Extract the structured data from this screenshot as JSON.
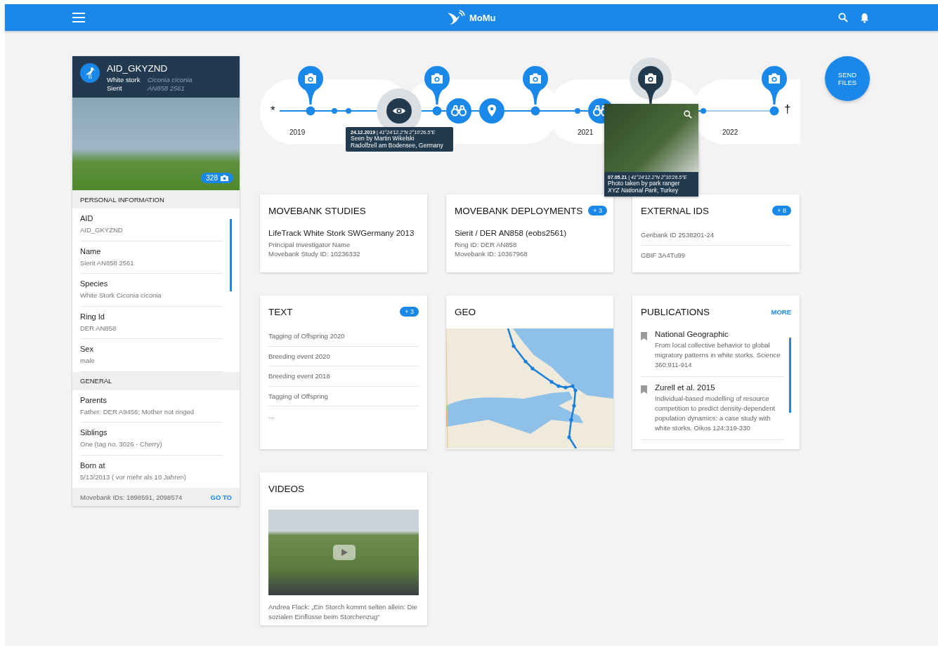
{
  "app_bar": {
    "title": "MoMu"
  },
  "profile": {
    "title": "AID_GKYZND",
    "rows": [
      {
        "label": "White stork",
        "value": "Ciconia ciconia"
      },
      {
        "label": "Sierit",
        "value": "AN858 2561"
      }
    ],
    "photo_count": "328",
    "sections": [
      {
        "title": "PERSONAL INFORMATION",
        "items": [
          {
            "label": "AID",
            "value": "AID_GKYZND"
          },
          {
            "label": "Name",
            "value": "Sierit AN858 2561"
          },
          {
            "label": "Species",
            "value": "White Stork Ciconia ciconia"
          },
          {
            "label": "Ring Id",
            "value": "DER AN858"
          },
          {
            "label": "Sex",
            "value": "male"
          }
        ]
      },
      {
        "title": "GENERAL",
        "items": [
          {
            "label": "Parents",
            "value": "Father: DER A9456; Mother not ringed"
          },
          {
            "label": "Siblings",
            "value": "One (tag no. 3026 - Cherry)"
          },
          {
            "label": "Born at",
            "value": "5/13/2013 ( vor mehr als 10 Jahren)"
          }
        ]
      }
    ],
    "footer": {
      "text": "Movebank IDs: 1898591, 2098574",
      "link": "GO TO"
    }
  },
  "timeline": {
    "start_mark": "*",
    "end_mark": "†",
    "years": [
      "2019",
      "2021",
      "2022"
    ],
    "events": [
      {
        "kind": "photo",
        "selected": false
      },
      {
        "kind": "dot",
        "selected": false
      },
      {
        "kind": "dot",
        "selected": false
      },
      {
        "kind": "sighting",
        "selected": true,
        "tooltip": {
          "header": "**24.12.2019** | *41°24'12.2\"N 2°10'26.5\"E*",
          "lines": [
            "Seen by Martin Wikelski",
            "Radolfzell am Bodensee, Germany"
          ]
        }
      },
      {
        "kind": "photo",
        "selected": false
      },
      {
        "kind": "observation",
        "selected": false
      },
      {
        "kind": "location",
        "selected": false
      },
      {
        "kind": "photo",
        "selected": false
      },
      {
        "kind": "dot",
        "selected": false
      },
      {
        "kind": "observation",
        "selected": false
      },
      {
        "kind": "photo",
        "selected": true,
        "tooltip": {
          "header": "**07.05.21** | *41°24'12.2\"N 2°10'26.5\"E*",
          "lines": [
            "Photo taken by park ranger",
            "*XYZ National Park*, Turkey"
          ]
        }
      },
      {
        "kind": "dot",
        "selected": false
      },
      {
        "kind": "photo",
        "selected": false
      }
    ]
  },
  "send_button": "SEND FILES",
  "cards": [
    {
      "kind": "detail",
      "title": "MOVEBANK STUDIES",
      "heading": "LifeTrack White Stork SWGermany 2013",
      "lines": [
        "Principal Investigator Name",
        "Movebank Study ID: 10236332"
      ]
    },
    {
      "kind": "detail",
      "title": "MOVEBANK DEPLOYMENTS",
      "badge": "+ 3",
      "heading": "Sierit / DER AN858 (eobs2561)",
      "lines": [
        "Ring ID: DER AN858",
        "Movebank ID: 10367968"
      ]
    },
    {
      "kind": "list",
      "title": "EXTERNAL IDS",
      "badge": "+ 8",
      "items": [
        "Genbank ID 2538201-24",
        "GBIF 3A4Tu99"
      ]
    },
    {
      "kind": "list",
      "title": "TEXT",
      "badge": "+ 3",
      "items": [
        "Tagging of Offspring 2020",
        "Breeding event 2020",
        "Breeding event 2018",
        "Tagging of Offspring",
        "..."
      ]
    },
    {
      "kind": "map",
      "title": "GEO"
    },
    {
      "kind": "publications",
      "title": "PUBLICATIONS",
      "link": "MORE",
      "items": [
        {
          "title": "National Geographic",
          "text": "From local collective behavior to global migratory patterns in white storks. Science 360:911-914"
        },
        {
          "title": "Zurell et al. 2015",
          "text": "Individual-based modelling of resource competition to predict density-dependent population dynamics: a case study with white storks. Oikos 124:319-330"
        }
      ]
    },
    {
      "kind": "video",
      "title": "VIDEOS",
      "caption": "Andrea Flack: „Ein Storch kommt selten allein: Die sozialen Einflüsse beim Storchenzug“"
    }
  ]
}
